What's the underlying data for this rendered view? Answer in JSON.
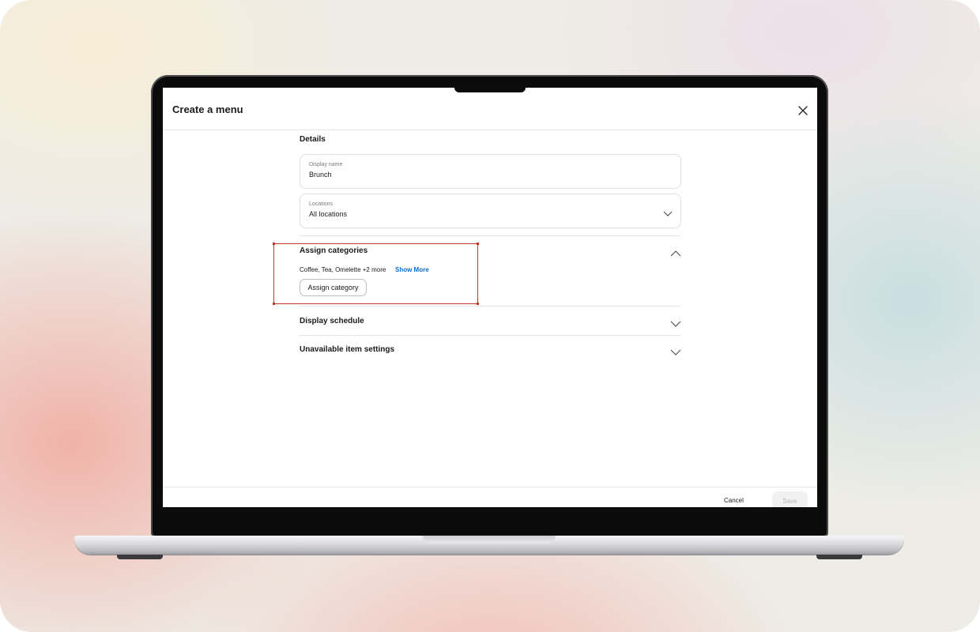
{
  "modal": {
    "title": "Create a menu",
    "close_icon": "close-icon"
  },
  "details": {
    "heading": "Details",
    "display_name": {
      "label": "Display name",
      "value": "Brunch"
    },
    "locations": {
      "label": "Locations",
      "value": "All locations",
      "icon": "chevron-down-icon"
    }
  },
  "assign_categories": {
    "heading": "Assign categories",
    "expanded": true,
    "icon": "chevron-up-icon",
    "categories_text": "Coffee, Tea, Omelette +2 more",
    "show_more_label": "Show More",
    "button_label": "Assign category"
  },
  "display_schedule": {
    "heading": "Display schedule",
    "icon": "chevron-down-icon"
  },
  "unavailable_settings": {
    "heading": "Unavailable item settings",
    "icon": "chevron-down-icon"
  },
  "footer": {
    "cancel_label": "Cancel",
    "save_label": "Save"
  },
  "colors": {
    "link": "#0a6ccf",
    "highlight": "#c0392b"
  }
}
